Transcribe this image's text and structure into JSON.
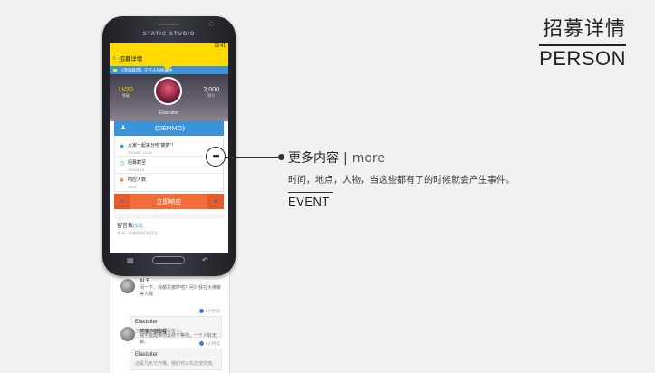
{
  "heading": {
    "title_cn": "招募详情",
    "title_en": "PERSON"
  },
  "phone": {
    "brand": "STATIC STUDIO",
    "status_time": "12:41"
  },
  "app": {
    "back": "‹",
    "title": "招募详情",
    "notice": "《英雄联盟》正在火热招募中",
    "profile": {
      "level": "LV30",
      "level_label": "等级",
      "points": "2,000",
      "points_label": "积分",
      "name": "Elastuiter"
    },
    "group": {
      "name": "《DEMMO》"
    },
    "rows": [
      {
        "title": "大家一起来分吃“披萨”！",
        "sub": "2015/8/7 12:30"
      },
      {
        "title": "招募截至",
        "sub": "2015/9/18"
      },
      {
        "title": "响应人数",
        "sub": "18/30"
      }
    ],
    "respond_label": "立即响应",
    "board": {
      "title": "留言板",
      "count": "(13)",
      "sub": "来,听一听哪些你们的声音"
    }
  },
  "comments": [
    {
      "name": "ALE",
      "text": "闲一下，我都发披萨啦？另外我在大佛旁等人喔",
      "reply_tag": "8小时前",
      "reply_name": "Elastuiter",
      "reply_text": "当然有，来者都是客人。"
    },
    {
      "name": "阿葵阿慈哦",
      "text": "我不能再带你去终于等你，一个人好无聊。",
      "reply_tag": "6小时前",
      "reply_name": "Elastuiter",
      "reply_text": "还是几天才开哦，我们可以先交流交流。"
    }
  ],
  "callout": {
    "dots": "•••",
    "head_cn": "更多内容",
    "sep": "|",
    "head_en": "more",
    "body": "时间，地点，人物，当这些都有了的时候就会产生事件。",
    "event": "EVENT"
  }
}
